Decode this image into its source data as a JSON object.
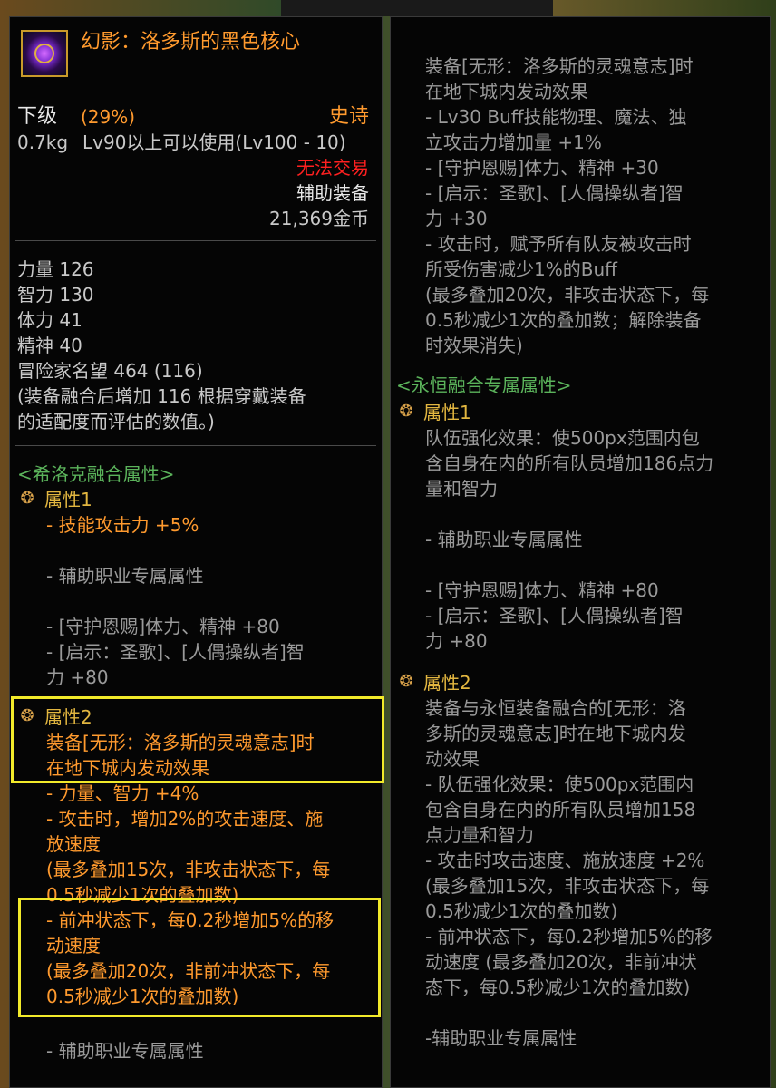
{
  "item": {
    "name": "幻影：洛多斯的黑色核心",
    "grade": "下级",
    "grade_pct": "(29%)",
    "rarity": "史诗",
    "weight": "0.7kg",
    "level_req": "Lv90以上可以使用(Lv100 - 10)",
    "trade": "无法交易",
    "slot": "辅助装备",
    "price": "21,369金币"
  },
  "stats": [
    "力量 126",
    "智力 130",
    "体力 41",
    "精神 40",
    "冒险家名望 464 (116)",
    "(装备融合后增加 116 根据穿戴装备",
    "的适配度而评估的数值。)"
  ],
  "left_fusion": {
    "title": "<希洛克融合属性>",
    "attr1_label": "属性1",
    "attr1_lines": [
      "- 技能攻击力 +5%",
      "- 辅助职业专属属性",
      "- [守护恩赐]体力、精神 +80",
      "- [启示：圣歌]、[人偶操纵者]智",
      "力 +80"
    ],
    "attr2_label": "属性2",
    "attr2_lines": [
      "装备[无形：洛多斯的灵魂意志]时",
      "在地下城内发动效果",
      "- 力量、智力 +4%",
      "- 攻击时，增加2%的攻击速度、施",
      "放速度",
      "(最多叠加15次，非攻击状态下，每",
      "0.5秒减少1次的叠加数)",
      "- 前冲状态下，每0.2秒增加5%的移",
      "动速度",
      "(最多叠加20次，非前冲状态下，每",
      "0.5秒减少1次的叠加数)",
      "- 辅助职业专属属性"
    ]
  },
  "right": {
    "lines_top": [
      "装备[无形：洛多斯的灵魂意志]时",
      "在地下城内发动效果",
      "- Lv30 Buff技能物理、魔法、独",
      "立攻击力增加量 +1%",
      "- [守护恩赐]体力、精神 +30",
      "- [启示：圣歌]、[人偶操纵者]智",
      "力 +30",
      "- 攻击时，赋予所有队友被攻击时",
      "所受伤害减少1%的Buff",
      "(最多叠加20次，非攻击状态下，每",
      "0.5秒减少1次的叠加数；解除装备",
      "时效果消失)"
    ],
    "fusion_title": "<永恒融合专属属性>",
    "attr1_label": "属性1",
    "attr1_lines": [
      "队伍强化效果：使500px范围内包",
      "含自身在内的所有队员增加186点力",
      "量和智力",
      "- 辅助职业专属属性",
      "- [守护恩赐]体力、精神 +80",
      "- [启示：圣歌]、[人偶操纵者]智",
      "力 +80"
    ],
    "attr2_label": "属性2",
    "attr2_lines": [
      "装备与永恒装备融合的[无形：洛",
      "多斯的灵魂意志]时在地下城内发",
      "动效果",
      "- 队伍强化效果：使500px范围内",
      "包含自身在内的所有队员增加158",
      "点力量和智力",
      "- 攻击时攻击速度、施放速度 +2%",
      "(最多叠加15次，非攻击状态下，每",
      "0.5秒减少1次的叠加数)",
      "- 前冲状态下，每0.2秒增加5%的移",
      "动速度 (最多叠加20次，非前冲状",
      "态下，每0.5秒减少1次的叠加数)",
      "-辅助职业专属属性"
    ]
  },
  "icons": {
    "item": "purple-core-icon",
    "attr": "swirl-attribute-icon"
  },
  "colors": {
    "highlight": "#f2ea2a",
    "epic": "#ff9a2e",
    "untradable": "#ff2020"
  }
}
